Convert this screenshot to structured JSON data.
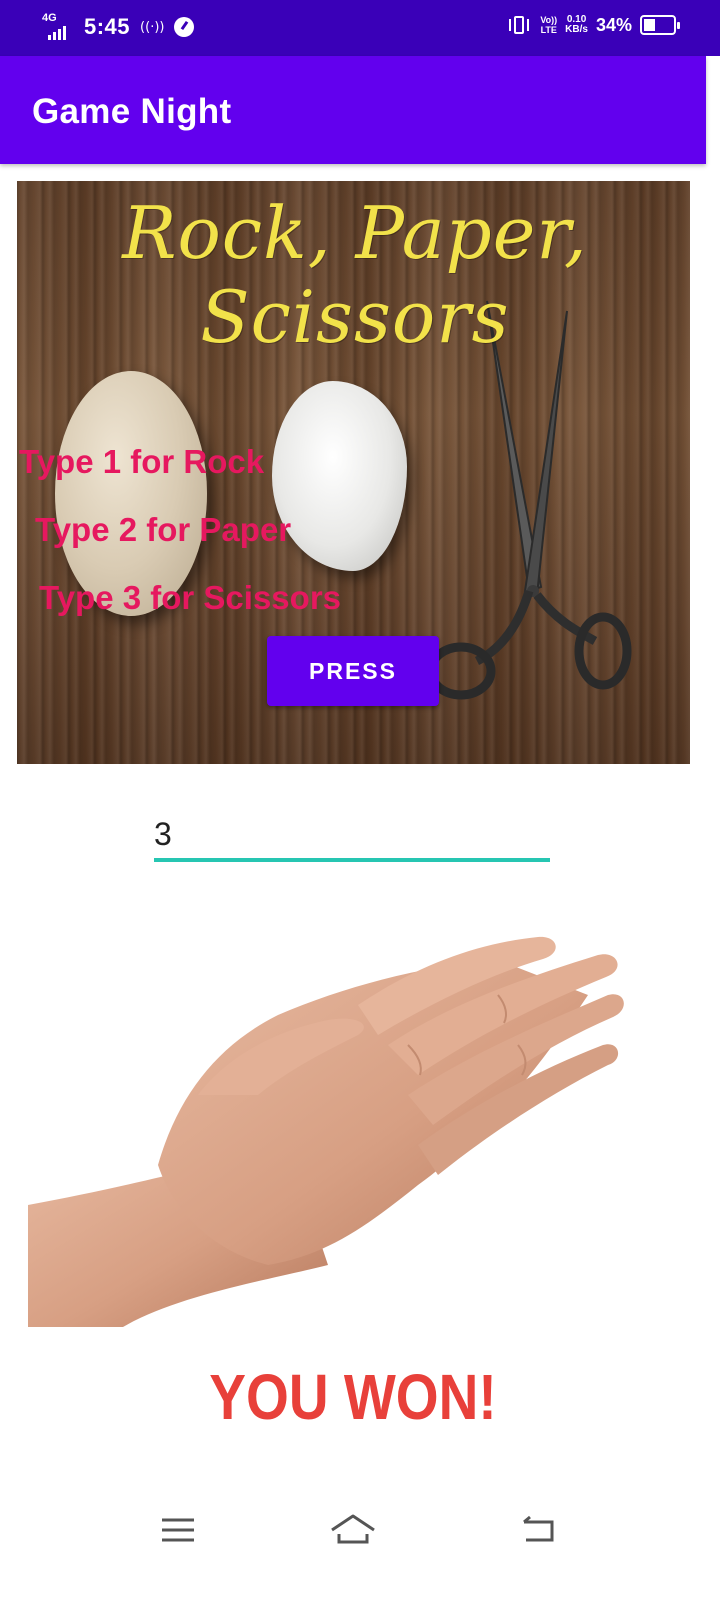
{
  "status_bar": {
    "network": "4G",
    "time": "5:45",
    "hotspot_icon": "hotspot-icon",
    "data_saver_icon": "data-saver-icon",
    "vibrate_icon": "vibrate-icon",
    "volte_top": "Vo))",
    "volte_bottom": "LTE",
    "speed_value": "0.10",
    "speed_unit": "KB/s",
    "battery_percent": "34%",
    "battery_level": 0.34
  },
  "app_bar": {
    "title": "Game Night"
  },
  "banner": {
    "title": "Rock, Paper, Scissors",
    "instructions": [
      "Type 1 for Rock",
      "Type 2 for Paper",
      "Type 3 for Scissors"
    ],
    "press_button_label": "PRESS"
  },
  "input": {
    "value": "3"
  },
  "result": {
    "text": "YOU WON!"
  },
  "colors": {
    "status_bar": "#3a00b8",
    "app_bar": "#6200ee",
    "button": "#6200ee",
    "instruction_text": "#e6185f",
    "banner_title": "#f2e24a",
    "input_underline": "#26c6b2",
    "result_text": "#e8403a"
  },
  "nav_bar": {
    "icons": [
      "menu-icon",
      "home-icon",
      "back-icon"
    ]
  }
}
